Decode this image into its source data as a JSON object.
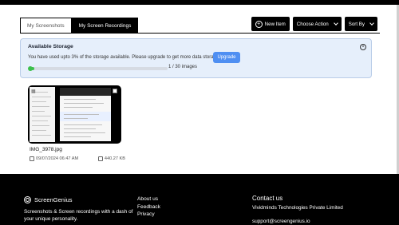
{
  "tabs": [
    {
      "label": "My Screenshots",
      "active": false
    },
    {
      "label": "My Screen Recordings",
      "active": true
    }
  ],
  "toolbar": {
    "new_item": "New Item",
    "choose_action": "Choose Action",
    "sort_by": "Sort By"
  },
  "storage": {
    "title": "Available Storage",
    "message": "You have used upto 3% of the storage available. Please upgrade to get more data storage.",
    "upgrade_label": "Upgrade",
    "used_count": 1,
    "total_count": 30,
    "progress_text": "1 / 30 images",
    "progress_fraction": 0.033
  },
  "files": [
    {
      "name": "IMG_3978.jpg",
      "date": "09/07/2024 06:47 AM",
      "size": "440.27 KB"
    }
  ],
  "footer": {
    "brand": "ScreenGenius",
    "tagline": "Screenshots & Screen recordings with a dash of your unique personality.",
    "links": [
      "About us",
      "Feedback",
      "Privacy"
    ],
    "contact_title": "Contact us",
    "company": "Vividminds Technologies Private Limited",
    "email": "support@screengenius.io"
  },
  "colors": {
    "accent": "#4f8ff2",
    "progress": "#3cc04c",
    "banner_bg": "#e6effb",
    "dark": "#000000"
  },
  "icons": [
    "plus-circle-icon",
    "chevron-down-icon",
    "close-circle-icon",
    "calendar-icon",
    "file-size-icon",
    "brand-logo-icon"
  ]
}
